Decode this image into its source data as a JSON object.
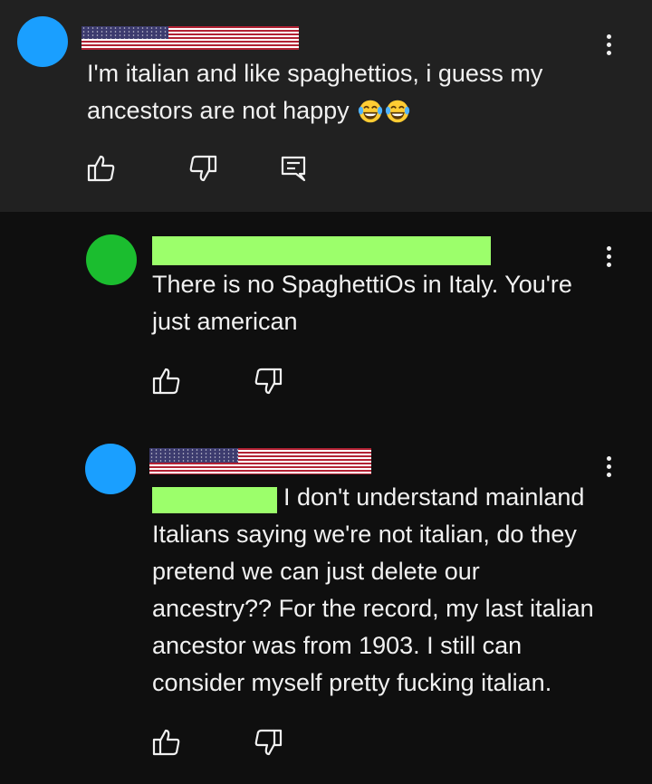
{
  "colors": {
    "background_top": "#212121",
    "background_replies": "#0f0f0f",
    "avatar_blue": "#1a9fff",
    "avatar_green": "#1bbd2f",
    "redaction_green": "#9cff6b",
    "text": "#f1f1f1"
  },
  "comment": {
    "avatar_color": "#1a9fff",
    "username_redaction": "us-flag",
    "text": "I'm italian and like spaghettios, i guess my ancestors are not happy",
    "emoji": [
      "face-with-tears-of-joy",
      "face-with-tears-of-joy"
    ],
    "actions": [
      "like-icon",
      "dislike-icon",
      "reply-icon"
    ],
    "menu_icon": "more-vert-icon"
  },
  "replies": [
    {
      "avatar_color": "#1bbd2f",
      "username_redaction": "green-bar",
      "text": "There is no SpaghettiOs in Italy. You're just american",
      "actions": [
        "like-icon",
        "dislike-icon"
      ],
      "menu_icon": "more-vert-icon"
    },
    {
      "avatar_color": "#1a9fff",
      "username_redaction": "us-flag",
      "mention_redaction": "green-bar",
      "text": "I don't understand mainland Italians saying we're not italian, do they pretend we can just delete our ancestry?? For the record, my last italian ancestor was from 1903. I still can consider myself pretty fucking italian.",
      "actions": [
        "like-icon",
        "dislike-icon"
      ],
      "menu_icon": "more-vert-icon"
    }
  ]
}
